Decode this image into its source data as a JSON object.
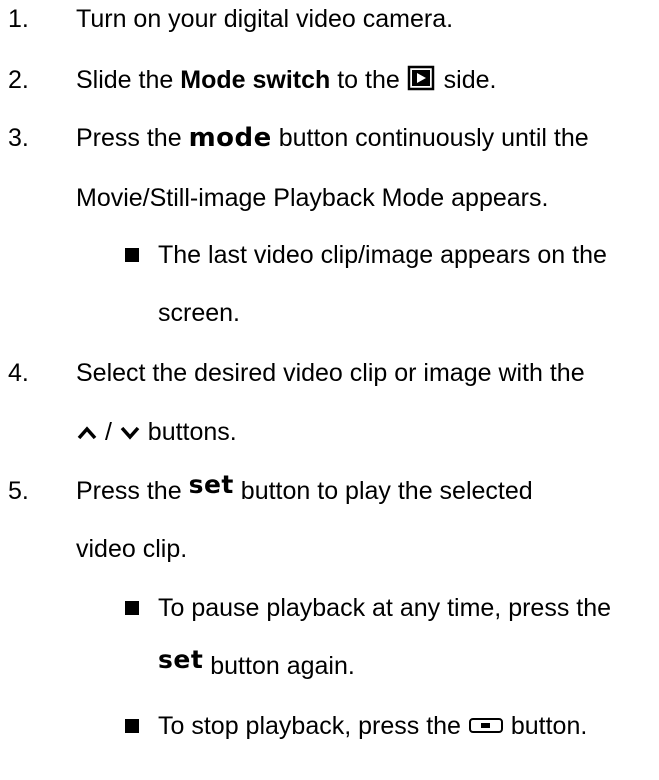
{
  "steps": [
    {
      "number": "1.",
      "text": "Turn on your digital video camera."
    },
    {
      "number": "2.",
      "pre": "Slide the ",
      "bold": "Mode switch",
      "mid": " to the ",
      "icon": "playback-icon",
      "post": " side."
    },
    {
      "number": "3.",
      "pre": "Press the ",
      "key": "mode",
      "post": " button continuously until the",
      "cont": "Movie/Still-image Playback Mode appears."
    },
    {
      "number": "4.",
      "line1": "Select the desired video clip or image with the",
      "line2_sep": " / ",
      "line2_post": " buttons.",
      "icons": [
        "up-arrow-icon",
        "down-arrow-icon"
      ]
    },
    {
      "number": "5.",
      "pre": "Press the ",
      "key": "set",
      "post": " button to play the selected",
      "cont": "video clip."
    }
  ],
  "bullets": [
    {
      "line1": "The last video clip/image appears on the",
      "line2": "screen."
    },
    {
      "line1": "To pause playback at any time, press the",
      "key": "set",
      "line2_post": " button again."
    },
    {
      "pre": "To stop playback, press the ",
      "icon": "stop-button-icon",
      "post": " button."
    }
  ]
}
